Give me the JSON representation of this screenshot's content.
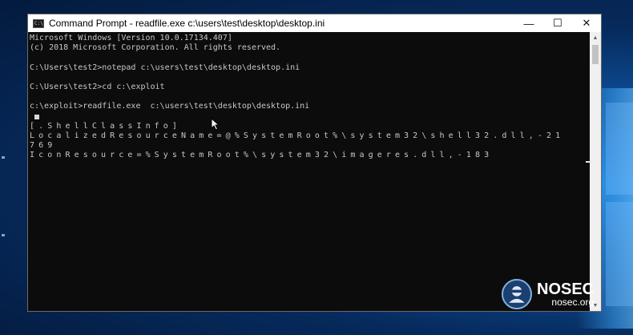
{
  "window": {
    "title": "Command Prompt - readfile.exe  c:\\users\\test\\desktop\\desktop.ini",
    "controls": {
      "minimize": "—",
      "maximize": "☐",
      "close": "✕"
    }
  },
  "console": {
    "lines": [
      "Microsoft Windows [Version 10.0.17134.407]",
      "(c) 2018 Microsoft Corporation. All rights reserved.",
      "",
      "C:\\Users\\test2>notepad c:\\users\\test\\desktop\\desktop.ini",
      "",
      "C:\\Users\\test2>cd c:\\exploit",
      "",
      "c:\\exploit>readfile.exe  c:\\users\\test\\desktop\\desktop.ini"
    ],
    "output_lines": [
      "[.ShellClassInfo]",
      "LocalizedResourceName=@%SystemRoot%\\system32\\shell32.dll,-21",
      "769",
      "IconResource=%SystemRoot%\\system32\\imageres.dll,-183"
    ]
  },
  "scrollbar": {
    "up": "▲",
    "down": "▼"
  },
  "watermark": {
    "name": "NOSEC",
    "url": "nosec.org"
  }
}
